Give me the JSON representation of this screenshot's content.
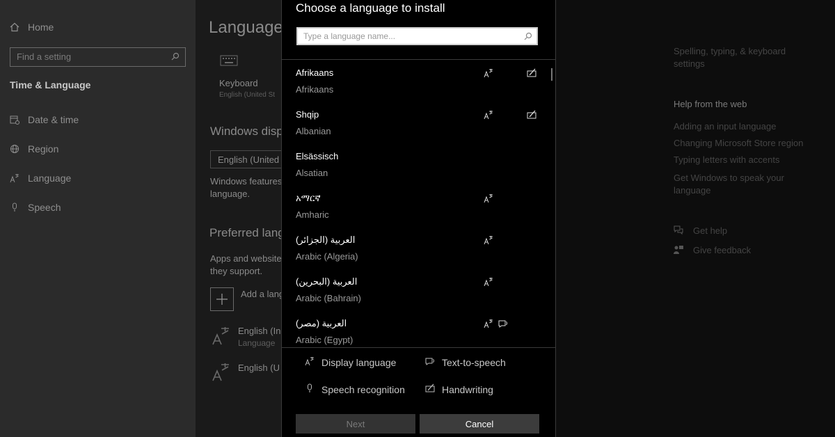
{
  "sidebar": {
    "home": "Home",
    "search_placeholder": "Find a setting",
    "section": "Time & Language",
    "items": [
      {
        "label": "Date & time",
        "icon": "calendar-clock-icon"
      },
      {
        "label": "Region",
        "icon": "globe-icon"
      },
      {
        "label": "Language",
        "icon": "language-icon"
      },
      {
        "label": "Speech",
        "icon": "microphone-icon"
      }
    ]
  },
  "main": {
    "title": "Language",
    "keyboard_label": "Keyboard",
    "keyboard_sub": "English (United St",
    "windows_display_heading": "Windows disp",
    "display_select_value": "English (United",
    "windows_features_text_1": "Windows features",
    "windows_features_text_2": "language.",
    "preferred_heading": "Preferred lang",
    "apps_text_1": "Apps and website",
    "apps_text_2": "they support.",
    "add_language": "Add a lang",
    "installed": [
      {
        "name": "English (In",
        "sub": "Language"
      },
      {
        "name": "English (U",
        "sub": ""
      }
    ]
  },
  "right_panel": {
    "related_link": "Spelling, typing, & keyboard settings",
    "help_heading": "Help from the web",
    "help_links": [
      "Adding an input language",
      "Changing Microsoft Store region",
      "Typing letters with accents",
      "Get Windows to speak your language"
    ],
    "get_help": "Get help",
    "give_feedback": "Give feedback"
  },
  "dialog": {
    "title": "Choose a language to install",
    "search_placeholder": "Type a language name...",
    "languages": [
      {
        "native": "Afrikaans",
        "english": "Afrikaans",
        "display": true,
        "handwriting": true,
        "tts": false
      },
      {
        "native": "Shqip",
        "english": "Albanian",
        "display": true,
        "handwriting": true,
        "tts": false
      },
      {
        "native": "Elsässisch",
        "english": "Alsatian",
        "display": false,
        "handwriting": false,
        "tts": false
      },
      {
        "native": "አማርኛ",
        "english": "Amharic",
        "display": true,
        "handwriting": false,
        "tts": false
      },
      {
        "native": "العربية (الجزائر)",
        "english": "Arabic (Algeria)",
        "display": true,
        "handwriting": false,
        "tts": false
      },
      {
        "native": "العربية (البحرين)",
        "english": "Arabic (Bahrain)",
        "display": true,
        "handwriting": false,
        "tts": false
      },
      {
        "native": "العربية (مصر)",
        "english": "Arabic (Egypt)",
        "display": true,
        "handwriting": false,
        "tts": true
      }
    ],
    "legend": {
      "display_language": "Display language",
      "text_to_speech": "Text-to-speech",
      "speech_recognition": "Speech recognition",
      "handwriting": "Handwriting"
    },
    "next_label": "Next",
    "cancel_label": "Cancel"
  }
}
